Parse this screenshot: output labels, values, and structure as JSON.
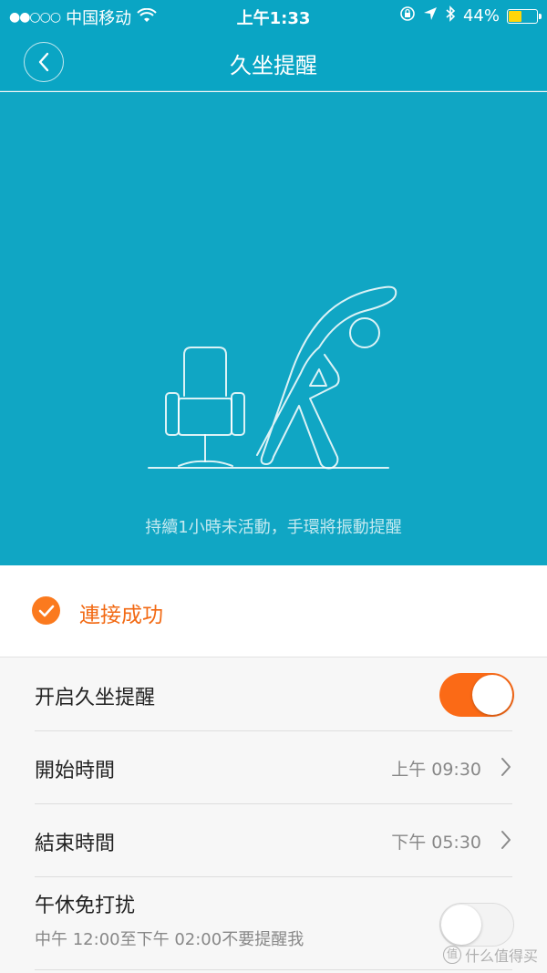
{
  "status_bar": {
    "signal": "●●○○○",
    "carrier": "中国移动",
    "time": "上午1:33",
    "battery_percent": "44%",
    "battery_level": 0.44
  },
  "nav": {
    "title": "久坐提醒"
  },
  "hero": {
    "caption": "持續1小時未活動，手環將振動提醒"
  },
  "connection": {
    "label": "連接成功",
    "color": "#f26a14"
  },
  "settings": {
    "sedentary_toggle": {
      "label": "开启久坐提醒",
      "on": true
    },
    "start_time": {
      "label": "開始時間",
      "value": "上午 09:30"
    },
    "end_time": {
      "label": "結束時間",
      "value": "下午 05:30"
    },
    "lunch_break": {
      "label": "午休免打扰",
      "sublabel": "中午 12:00至下午 02:00不要提醒我",
      "on": false
    }
  },
  "watermark": {
    "badge": "值",
    "text": "什么值得买"
  },
  "colors": {
    "accent": "#0aa5c4",
    "toggle_on": "#fb6a16"
  }
}
